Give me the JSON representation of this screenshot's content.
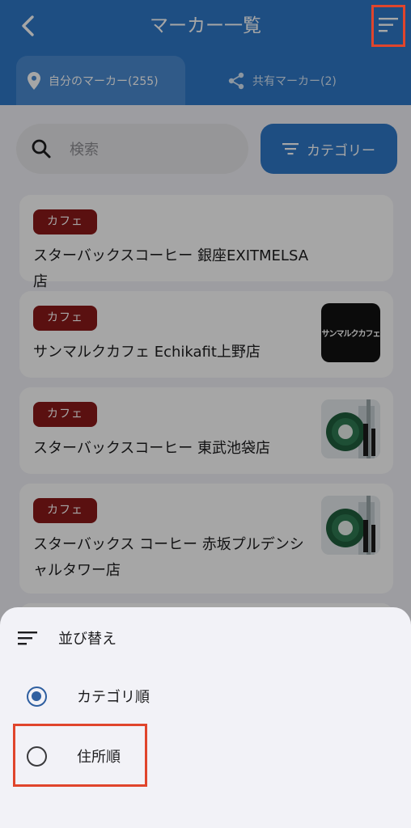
{
  "header": {
    "title": "マーカー一覧",
    "back_icon": "chevron-left-icon",
    "sort_icon": "sort-lines-icon"
  },
  "tabs": [
    {
      "label": "自分のマーカー(255)",
      "icon": "map-pin-icon",
      "active": true
    },
    {
      "label": "共有マーカー(2)",
      "icon": "share-icon",
      "active": false
    }
  ],
  "search": {
    "placeholder": "検索",
    "icon": "search-icon"
  },
  "category_button": {
    "label": "カテゴリー",
    "icon": "filter-icon"
  },
  "markers": [
    {
      "category": "カフェ",
      "name": "スターバックスコーヒー 銀座EXITMELSA店"
    },
    {
      "category": "カフェ",
      "name": "サンマルクカフェ Echikafit上野店",
      "thumb_text": "サンマルクカフェ"
    },
    {
      "category": "カフェ",
      "name": "スターバックスコーヒー 東武池袋店"
    },
    {
      "category": "カフェ",
      "name": "スターバックス コーヒー 赤坂プルデンシャルタワー店"
    }
  ],
  "sort_sheet": {
    "title": "並び替え",
    "options": [
      {
        "label": "カテゴリ順",
        "selected": true
      },
      {
        "label": "住所順",
        "selected": false
      }
    ]
  },
  "colors": {
    "primary": "#2f78c8",
    "badge": "#8b1a1a",
    "highlight": "#e0452c",
    "radio_selected": "#2f5fa0"
  }
}
